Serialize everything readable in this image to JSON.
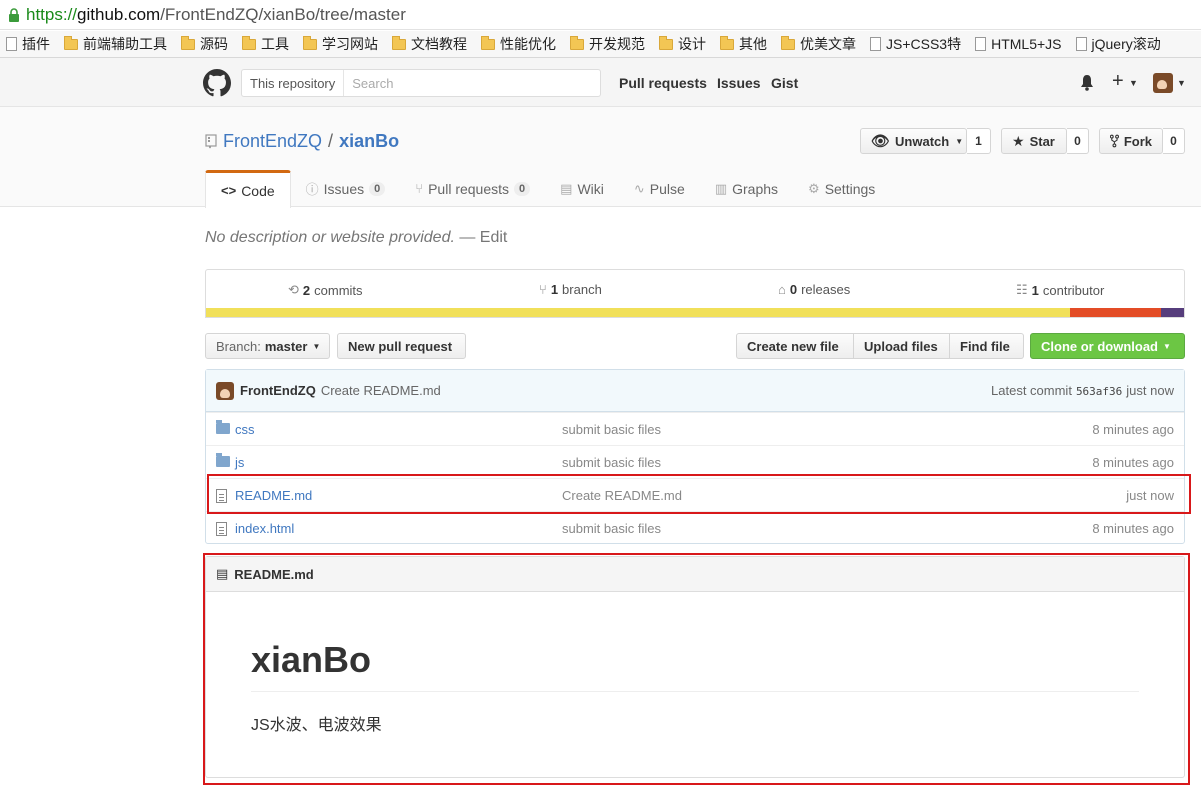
{
  "browser": {
    "url_scheme": "https://",
    "url_host": "github.com",
    "url_path": "/FrontEndZQ/xianBo/tree/master",
    "bookmarks": [
      {
        "label": "插件",
        "icon": "page-icon"
      },
      {
        "label": "前端辅助工具",
        "icon": "folder-icon"
      },
      {
        "label": "源码",
        "icon": "folder-icon"
      },
      {
        "label": "工具",
        "icon": "folder-icon"
      },
      {
        "label": "学习网站",
        "icon": "folder-icon"
      },
      {
        "label": "文档教程",
        "icon": "folder-icon"
      },
      {
        "label": "性能优化",
        "icon": "folder-icon"
      },
      {
        "label": "开发规范",
        "icon": "folder-icon"
      },
      {
        "label": "设计",
        "icon": "folder-icon"
      },
      {
        "label": "其他",
        "icon": "folder-icon"
      },
      {
        "label": "优美文章",
        "icon": "folder-icon"
      },
      {
        "label": "JS+CSS3特",
        "icon": "page-icon"
      },
      {
        "label": "HTML5+JS",
        "icon": "page-icon"
      },
      {
        "label": "jQuery滚动",
        "icon": "page-icon"
      }
    ]
  },
  "header": {
    "search_scope": "This repository",
    "search_placeholder": "Search",
    "nav": [
      "Pull requests",
      "Issues",
      "Gist"
    ]
  },
  "repo": {
    "owner": "FrontEndZQ",
    "separator": "/",
    "name": "xianBo",
    "unwatch_label": "Unwatch",
    "watch_count": "1",
    "star_label": "Star",
    "star_count": "0",
    "fork_label": "Fork",
    "fork_count": "0",
    "tabs": [
      {
        "label": "Code",
        "counter": ""
      },
      {
        "label": "Issues",
        "counter": "0"
      },
      {
        "label": "Pull requests",
        "counter": "0"
      },
      {
        "label": "Wiki",
        "counter": ""
      },
      {
        "label": "Pulse",
        "counter": ""
      },
      {
        "label": "Graphs",
        "counter": ""
      },
      {
        "label": "Settings",
        "counter": ""
      }
    ],
    "description": "No description or website provided.",
    "description_sep": " — ",
    "edit_label": "Edit"
  },
  "summary": {
    "commits_num": "2",
    "commits_label": "commits",
    "branch_num": "1",
    "branch_label": "branch",
    "releases_num": "0",
    "releases_label": "releases",
    "contributor_num": "1",
    "contributor_label": "contributor",
    "lang_colors": [
      "#f1e05a",
      "#e34c26",
      "#563d7c"
    ],
    "lang_shares": [
      0.883,
      0.094,
      0.023
    ]
  },
  "toolbar": {
    "branch_prefix": "Branch:",
    "branch_name": "master",
    "new_pr": "New pull request",
    "create_file": "Create new file",
    "upload_files": "Upload files",
    "find_file": "Find file",
    "clone": "Clone or download",
    "clone_color": "#6cc644"
  },
  "latest_commit": {
    "author": "FrontEndZQ",
    "message": "Create README.md",
    "prefix": "Latest commit",
    "sha": "563af36",
    "age": "just now"
  },
  "files": [
    {
      "name": "css",
      "type": "dir",
      "message": "submit basic files",
      "age": "8 minutes ago"
    },
    {
      "name": "js",
      "type": "dir",
      "message": "submit basic files",
      "age": "8 minutes ago"
    },
    {
      "name": "README.md",
      "type": "file",
      "message": "Create README.md",
      "age": "just now"
    },
    {
      "name": "index.html",
      "type": "file",
      "message": "submit basic files",
      "age": "8 minutes ago"
    }
  ],
  "readme": {
    "filename": "README.md",
    "heading": "xianBo",
    "body": "JS水波、电波效果"
  },
  "highlight_color": "#d8181a"
}
